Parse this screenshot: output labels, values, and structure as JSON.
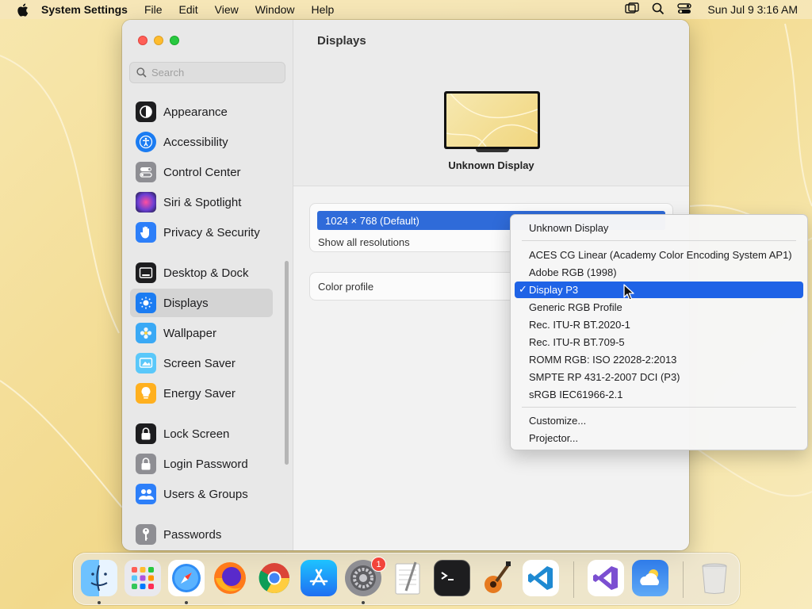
{
  "menubar": {
    "app_name": "System Settings",
    "menus": [
      "File",
      "Edit",
      "View",
      "Window",
      "Help"
    ],
    "clock": "Sun Jul 9  3:16 AM"
  },
  "sidebar": {
    "search_placeholder": "Search",
    "items": [
      {
        "label": "Appearance",
        "icon": "appearance-icon",
        "color": "#1d1d1f"
      },
      {
        "label": "Accessibility",
        "icon": "accessibility-icon",
        "color": "#1b7cf2"
      },
      {
        "label": "Control Center",
        "icon": "control-center-icon",
        "color": "#8e8e93"
      },
      {
        "label": "Siri & Spotlight",
        "icon": "siri-icon",
        "color": "#6b3fd4"
      },
      {
        "label": "Privacy & Security",
        "icon": "hand-icon",
        "color": "#2d7ff9"
      },
      {
        "label": "Desktop & Dock",
        "icon": "dock-icon",
        "color": "#1d1d1f"
      },
      {
        "label": "Displays",
        "icon": "brightness-icon",
        "color": "#1b7cf2",
        "selected": true
      },
      {
        "label": "Wallpaper",
        "icon": "flower-icon",
        "color": "#3aa9f5"
      },
      {
        "label": "Screen Saver",
        "icon": "screen-saver-icon",
        "color": "#5ac8fa"
      },
      {
        "label": "Energy Saver",
        "icon": "lightbulb-icon",
        "color": "#ffb01f"
      },
      {
        "label": "Lock Screen",
        "icon": "lock-icon",
        "color": "#1d1d1f"
      },
      {
        "label": "Login Password",
        "icon": "login-lock-icon",
        "color": "#8e8e93"
      },
      {
        "label": "Users & Groups",
        "icon": "users-icon",
        "color": "#2d7ff9"
      },
      {
        "label": "Passwords",
        "icon": "key-icon",
        "color": "#8e8e93"
      }
    ]
  },
  "content": {
    "title": "Displays",
    "display_name": "Unknown Display",
    "resolution_selected": "1024 × 768 (Default)",
    "show_all": "Show all resolutions",
    "color_profile_label": "Color profile"
  },
  "popup": {
    "header": "Unknown Display",
    "options": [
      "ACES CG Linear (Academy Color Encoding System AP1)",
      "Adobe RGB (1998)",
      "Display P3",
      "Generic RGB Profile",
      "Rec. ITU-R BT.2020-1",
      "Rec. ITU-R BT.709-5",
      "ROMM RGB: ISO 22028-2:2013",
      "SMPTE RP 431-2-2007 DCI (P3)",
      "sRGB IEC61966-2.1"
    ],
    "selected": "Display P3",
    "check_mark": "✓",
    "extra": [
      "Customize...",
      "Projector..."
    ]
  },
  "dock": {
    "apps": [
      {
        "name": "finder-icon",
        "running": true
      },
      {
        "name": "launchpad-icon",
        "running": false
      },
      {
        "name": "safari-icon",
        "running": true
      },
      {
        "name": "firefox-icon",
        "running": false
      },
      {
        "name": "chrome-icon",
        "running": false
      },
      {
        "name": "app-store-icon",
        "running": false
      },
      {
        "name": "system-settings-icon",
        "running": true,
        "badge": "1"
      },
      {
        "name": "textedit-icon",
        "running": false
      },
      {
        "name": "terminal-icon",
        "running": false
      },
      {
        "name": "garageband-icon",
        "running": false
      },
      {
        "name": "vscode-icon",
        "running": false
      },
      {
        "name": "visual-studio-icon",
        "running": false
      },
      {
        "name": "weather-icon",
        "running": false
      },
      {
        "name": "trash-icon",
        "running": false
      }
    ]
  }
}
